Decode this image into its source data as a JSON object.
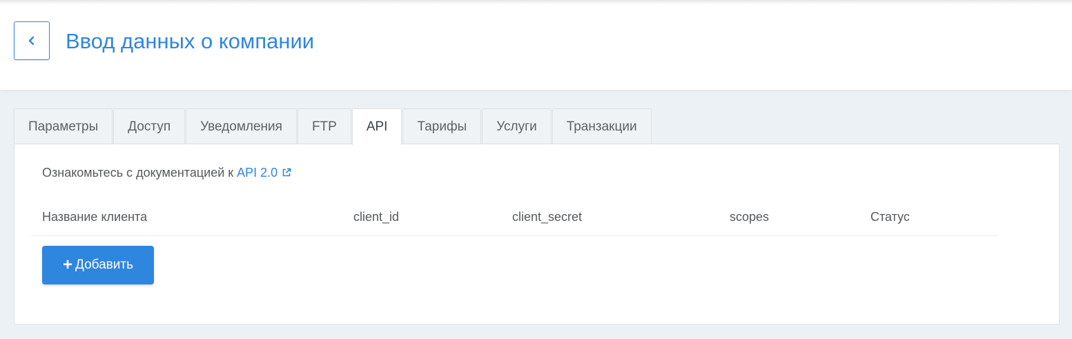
{
  "header": {
    "title": "Ввод данных о компании",
    "back_icon": "chevron-left-icon"
  },
  "tabs": [
    {
      "label": "Параметры",
      "active": false
    },
    {
      "label": "Доступ",
      "active": false
    },
    {
      "label": "Уведомления",
      "active": false
    },
    {
      "label": "FTP",
      "active": false
    },
    {
      "label": "API",
      "active": true
    },
    {
      "label": "Тарифы",
      "active": false
    },
    {
      "label": "Услуги",
      "active": false
    },
    {
      "label": "Транзакции",
      "active": false
    }
  ],
  "panel": {
    "doc_text": "Ознакомьтесь с документацией к ",
    "doc_link": "API 2.0",
    "doc_link_icon": "external-link-icon",
    "columns": [
      "Название клиента",
      "client_id",
      "client_secret",
      "scopes",
      "Статус"
    ],
    "add_button": {
      "icon": "+",
      "label": "Добавить"
    }
  },
  "colors": {
    "accent": "#2f86de",
    "background": "#ecf1f5",
    "text": "#55595c"
  }
}
